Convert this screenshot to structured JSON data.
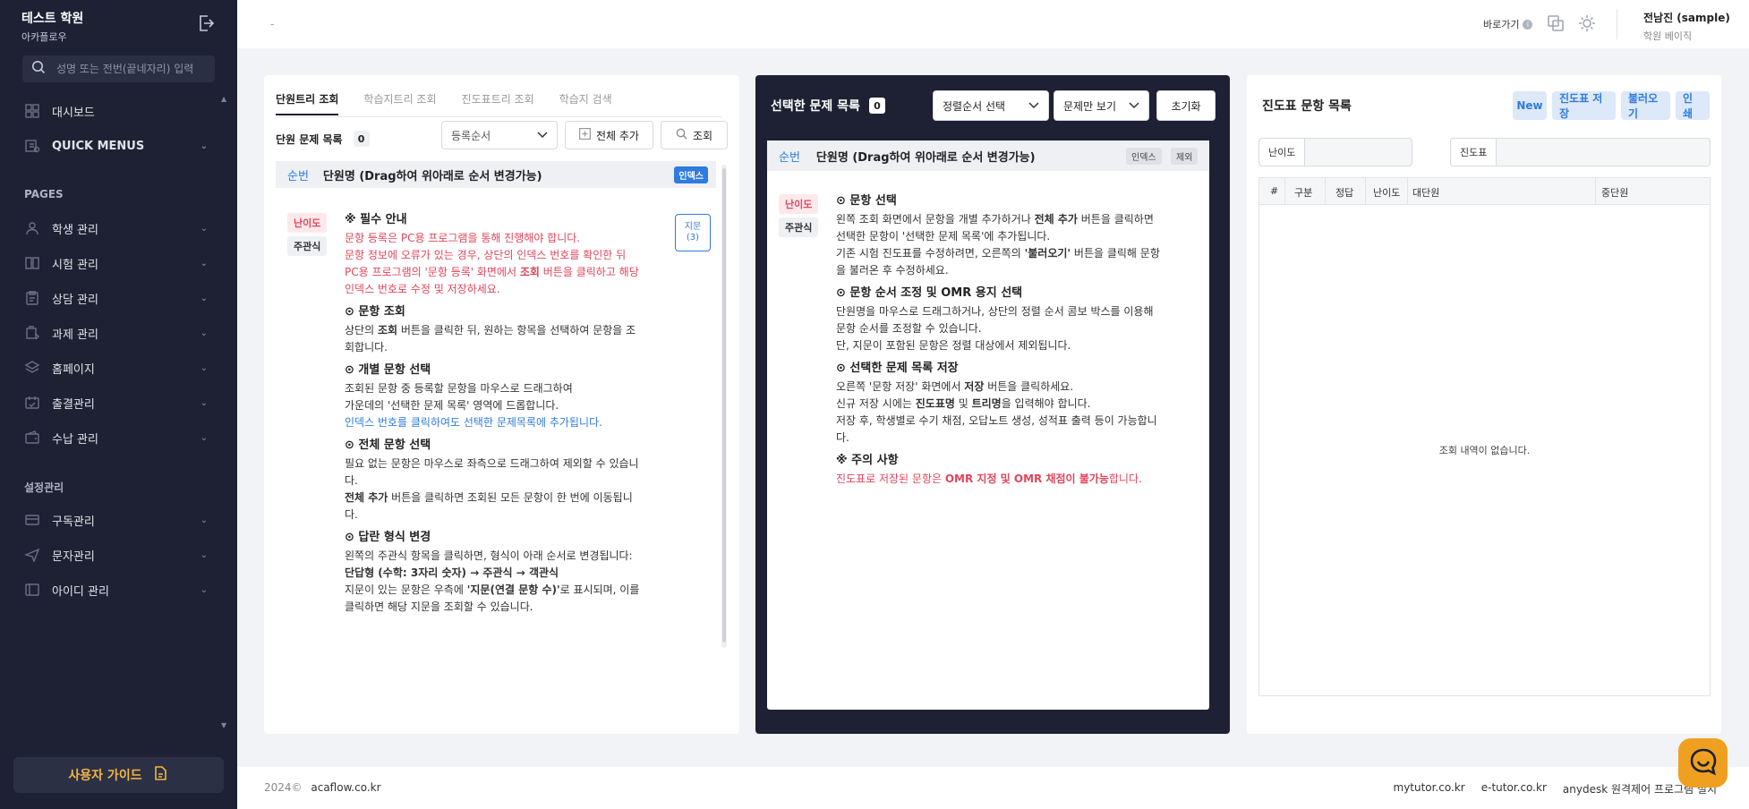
{
  "sidebar": {
    "brand_name": "테스트 학원",
    "brand_sub": "아카플로우",
    "search_placeholder": "성명 또는 전번(끝네자리) 입력",
    "top_items": [
      {
        "label": "대시보드"
      },
      {
        "label": "QUICK MENUS"
      }
    ],
    "pages_label": "PAGES",
    "pages": [
      {
        "label": "학생 관리",
        "icon": "person-icon"
      },
      {
        "label": "시험 관리",
        "icon": "book-icon"
      },
      {
        "label": "상담 관리",
        "icon": "clipboard-icon"
      },
      {
        "label": "과제 관리",
        "icon": "task-icon"
      },
      {
        "label": "홈페이지",
        "icon": "layers-icon"
      },
      {
        "label": "출결관리",
        "icon": "attendance-icon"
      },
      {
        "label": "수납 관리",
        "icon": "wallet-icon"
      }
    ],
    "settings_label": "설정관리",
    "settings": [
      {
        "label": "구독관리",
        "icon": "card-icon"
      },
      {
        "label": "문자관리",
        "icon": "paper-plane-icon"
      },
      {
        "label": "아이디 관리",
        "icon": "id-icon"
      }
    ],
    "guide_button": "사용자 가이드"
  },
  "header": {
    "crumb": "-",
    "shortcut": "바로가기",
    "user_name": "전남진 (sample)",
    "user_role": "학원 베이직"
  },
  "panel1": {
    "tabs": [
      "단원트리 조회",
      "학습지트리 조회",
      "진도표트리 조회",
      "학습지 검색"
    ],
    "list_title": "단원 문제 목록",
    "count": "0",
    "sort_select": "등록순서",
    "add_all": "전체 추가",
    "search_btn": "조회",
    "col_num": "순번",
    "col_name": "단원명 (Drag하여 위아래로 순서 변경가능)",
    "index_tag": "인덱스",
    "difficulty": "난이도",
    "qtype": "주관식",
    "jimun_line1": "지문",
    "jimun_line2": "(3)",
    "guide": {
      "h1": "※ 필수 안내",
      "r1": "문항 등록은 PC용 프로그램을 통해 진행해야 합니다.",
      "r2": "문항 정보에 오류가 있는 경우, 상단의 인덱스 번호를 확인한 뒤",
      "r3a": "PC용 프로그램의 '문항 등록' 화면에서 ",
      "r3b": "조회",
      "r3c": " 버튼을 클릭하고 해당",
      "r4": "인덱스 번호로 수정 및 저장하세요.",
      "h2": "⊙ 문항 조회",
      "s2a": "상단의 ",
      "s2b": "조회",
      "s2c": " 버튼을 클릭한 뒤, 원하는 항목을 선택하여 문항을 조",
      "s2d": "회합니다.",
      "h3": "⊙ 개별 문항 선택",
      "s3a": "조회된 문항 중 등록할 문항을 마우스로 드래그하여",
      "s3b": "가운데의 '선택한 문제 목록' 영역에 드롭합니다.",
      "s3c": "인덱스 번호를 클릭하여도 선택한 문제목록에 추가됩니다.",
      "h4": "⊙ 전체 문항 선택",
      "s4a": "필요 없는 문항은 마우스로 좌측으로 드래그하여 제외할 수 있습니",
      "s4b": "다.",
      "s4c": "전체 추가",
      "s4d": " 버튼을 클릭하면 조회된 모든 문항이 한 번에 이동됩니",
      "s4e": "다.",
      "h5": "⊙ 답란 형식 변경",
      "s5a": "왼쪽의 주관식 항목을 클릭하면, 형식이 아래 순서로 변경됩니다:",
      "s5b": "단답형 (수학: 3자리 숫자) → 주관식 → 객관식",
      "s5c": "지문이 있는 문항은 우측에 ",
      "s5d": "'지문(연결 문항 수)'",
      "s5e": "로 표시되며, 이를",
      "s5f": "클릭하면 해당 지문을 조회할 수 있습니다."
    }
  },
  "panel2": {
    "title": "선택한 문제 목록",
    "count": "0",
    "sort_select": "정렬순서 선택",
    "view_select": "문제만 보기",
    "reset": "초기화",
    "col_num": "순번",
    "col_name": "단원명 (Drag하여 위아래로 순서 변경가능)",
    "tag_index": "인덱스",
    "tag_exclude": "제외",
    "difficulty": "난이도",
    "qtype": "주관식",
    "guide": {
      "h1": "⊙ 문항 선택",
      "a1": "왼쪽 조회 화면에서 문항을 개별 추가하거나 ",
      "a2": "전체 추가",
      "a3": " 버튼을 클릭하면",
      "a4": "선택한 문항이 '선택한 문제 목록'에 추가됩니다.",
      "a5": "기존 시험 진도표를 수정하려면, 오른쪽의 ",
      "a6": "'불러오기'",
      "a7": " 버튼을 클릭해 문항",
      "a8": "을 불러온 후 수정하세요.",
      "h2": "⊙ 문항 순서 조정 및 OMR 용지 선택",
      "b1": "단원명을 마우스로 드래그하거나, 상단의 정렬 순서 콤보 박스를 이용해",
      "b2": "문항 순서를 조정할 수 있습니다.",
      "b3": "단, 지문이 포함된 문항은 정렬 대상에서 제외됩니다.",
      "h3": "⊙ 선택한 문제 목록 저장",
      "c1": "오른쪽 '문항 저장' 화면에서 ",
      "c2": "저장",
      "c3": " 버튼을 클릭하세요.",
      "c4": "신규 저장 시에는 ",
      "c5": "진도표명",
      "c6": " 및 ",
      "c7": "트리명",
      "c8": "을 입력해야 합니다.",
      "c9": "저장 후, 학생별로 수기 채점, 오답노트 생성, 성적표 출력 등이 가능합니",
      "c10": "다.",
      "h4": "※ 주의 사항",
      "d1": "진도표로 저장된 문항은 ",
      "d2": "OMR 지정 및 OMR 채점이 불가능",
      "d3": "합니다."
    }
  },
  "panel3": {
    "title": "진도표 문항 목록",
    "btn_new": "New",
    "btn_save": "진도표 저장",
    "btn_load": "불러오기",
    "btn_print": "인쇄",
    "filter_difficulty": "난이도",
    "filter_progress": "진도표",
    "columns": [
      "#",
      "구분",
      "정답",
      "난이도",
      "대단원",
      "중단원"
    ],
    "empty": "조회 내역이 없습니다."
  },
  "footer": {
    "year": "2024©",
    "site": "acaflow.co.kr",
    "links": [
      "mytutor.co.kr",
      "e-tutor.co.kr",
      "anydesk 원격제어 프로그램 설치"
    ]
  },
  "colors": {
    "sidebar_bg": "#1d2133",
    "accent_blue": "#2f7be0",
    "accent_red": "#e2455b",
    "guide_yellow": "#f2b544",
    "chat_orange": "#f0a020"
  }
}
